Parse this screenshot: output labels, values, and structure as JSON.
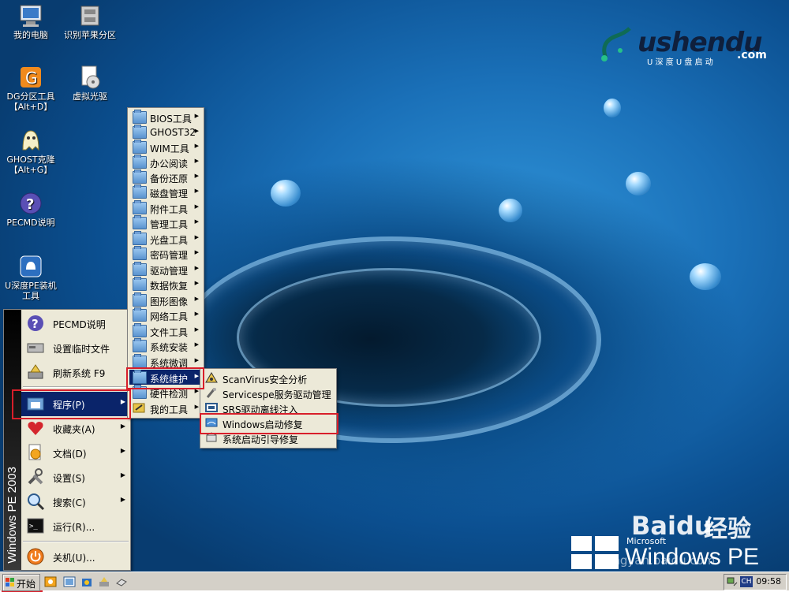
{
  "desktop_icons": [
    {
      "label": "我的电脑",
      "icon": "computer-icon"
    },
    {
      "label": "识别苹果分区",
      "icon": "disk-scan-icon"
    },
    {
      "label": "DG分区工具\n【Alt+D】",
      "icon": "diskgenius-icon"
    },
    {
      "label": "虚拟光驱",
      "icon": "virtual-cd-icon"
    },
    {
      "label": "GHOST克隆\n【Alt+G】",
      "icon": "ghost-icon"
    },
    {
      "label": "PECMD说明",
      "icon": "help-icon"
    },
    {
      "label": "U深度PE装机\n工具",
      "icon": "installer-icon"
    }
  ],
  "branding": {
    "logo_text": "ushendu",
    "logo_sub": "U 深 度  U 盘 启 动",
    "logo_com": ".com",
    "watermark_baidu": "Baidu",
    "watermark_jingyan": "经验",
    "watermark_ms": "Microsoft",
    "watermark_pe": "Windows PE",
    "watermark_url": "jingyan.baidu.com"
  },
  "start_menu": {
    "side_text": "Windows PE 2003",
    "items": [
      {
        "label": "PECMD说明",
        "icon": "help-icon",
        "arrow": false
      },
      {
        "label": "设置临时文件",
        "icon": "drive-icon",
        "arrow": false
      },
      {
        "label": "刷新系统 F9",
        "icon": "refresh-icon",
        "arrow": false
      },
      {
        "label": "程序(P)",
        "icon": "programs-icon",
        "arrow": true
      },
      {
        "label": "收藏夹(A)",
        "icon": "favorites-icon",
        "arrow": true
      },
      {
        "label": "文档(D)",
        "icon": "documents-icon",
        "arrow": true
      },
      {
        "label": "设置(S)",
        "icon": "settings-icon",
        "arrow": true
      },
      {
        "label": "搜索(C)",
        "icon": "search-icon",
        "arrow": true
      },
      {
        "label": "运行(R)...",
        "icon": "run-icon",
        "arrow": false
      },
      {
        "label": "关机(U)...",
        "icon": "shutdown-icon",
        "arrow": false
      }
    ]
  },
  "programs_menu": {
    "items": [
      "BIOS工具",
      "GHOST32",
      "WIM工具",
      "办公阅读",
      "备份还原",
      "磁盘管理",
      "附件工具",
      "管理工具",
      "光盘工具",
      "密码管理",
      "驱动管理",
      "数据恢复",
      "图形图像",
      "网络工具",
      "文件工具",
      "系统安装",
      "系统微调",
      "系统维护",
      "硬件检测",
      "我的工具"
    ],
    "highlighted": "系统维护"
  },
  "maintenance_menu": {
    "items": [
      "ScanVirus安全分析",
      "Servicespe服务驱动管理",
      "SRS驱动离线注入",
      "Windows启动修复",
      "系统启动引导修复"
    ]
  },
  "taskbar": {
    "start_label": "开始",
    "language": "CH",
    "clock": "09:58"
  }
}
